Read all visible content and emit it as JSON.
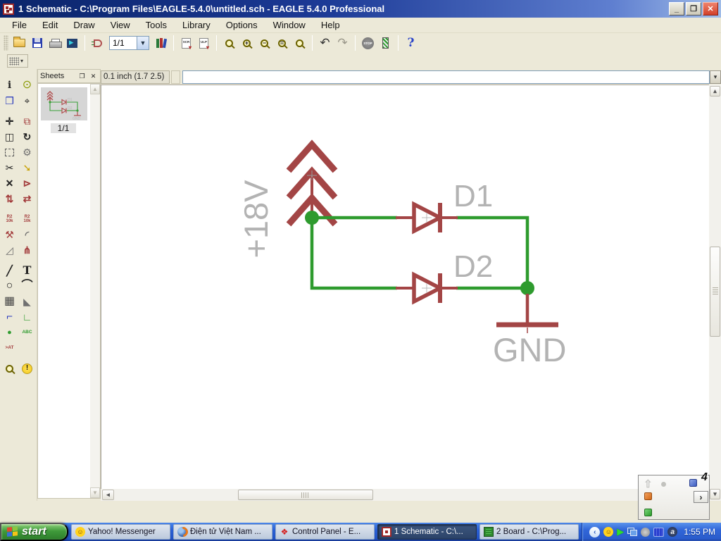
{
  "window": {
    "title": "1 Schematic - C:\\Program Files\\EAGLE-5.4.0\\untitled.sch - EAGLE 5.4.0 Professional",
    "minimize_glyph": "_",
    "restore_glyph": "❐",
    "close_glyph": "✕"
  },
  "menu": {
    "items": [
      "File",
      "Edit",
      "Draw",
      "View",
      "Tools",
      "Library",
      "Options",
      "Window",
      "Help"
    ]
  },
  "toolbar": {
    "sheet_selector": "1/1",
    "combo_arrow": "▼",
    "scr_label": "SCR",
    "ulp_label": "ULP",
    "zoom_in_overlay": "+",
    "zoom_out_overlay": "−",
    "zoom_select_overlay": "=",
    "undo_glyph": "↶",
    "redo_glyph": "↷",
    "stop_label": "STOP",
    "help_label": "?"
  },
  "command_bar": {
    "coordinate_display": "0.1 inch (1.7 2.5)",
    "command_value": ""
  },
  "sheets": {
    "title": "Sheets",
    "float_glyph": "❐",
    "close_glyph": "✕",
    "current_sheet": "1/1"
  },
  "palette": {
    "tools": [
      {
        "name": "info",
        "glyph": "i"
      },
      {
        "name": "show",
        "glyph": "⊙"
      },
      {
        "name": "display",
        "glyph": "❐"
      },
      {
        "name": "mark",
        "glyph": "⌖"
      },
      {
        "name": "move",
        "glyph": "✛"
      },
      {
        "name": "copy",
        "glyph": "⧉"
      },
      {
        "name": "mirror",
        "glyph": "◫"
      },
      {
        "name": "rotate",
        "glyph": "↻"
      },
      {
        "name": "group",
        "glyph": ""
      },
      {
        "name": "change",
        "glyph": "⚙"
      },
      {
        "name": "cut",
        "glyph": "✂"
      },
      {
        "name": "paste",
        "glyph": "➘"
      },
      {
        "name": "delete",
        "glyph": "✕"
      },
      {
        "name": "add",
        "glyph": "⊳"
      },
      {
        "name": "pinswap",
        "glyph": "⇅"
      },
      {
        "name": "gateswap",
        "glyph": "⇄"
      },
      {
        "name": "name",
        "glyph": "R2\n10k"
      },
      {
        "name": "value",
        "glyph": "R2\n10k"
      },
      {
        "name": "smash",
        "glyph": "⚒"
      },
      {
        "name": "miter",
        "glyph": "◜"
      },
      {
        "name": "miter2",
        "glyph": "◿"
      },
      {
        "name": "optimize",
        "glyph": "⋔"
      },
      {
        "name": "wire",
        "glyph": "╱"
      },
      {
        "name": "text",
        "glyph": "T"
      },
      {
        "name": "circle",
        "glyph": "○"
      },
      {
        "name": "arc",
        "glyph": "⌒"
      },
      {
        "name": "rect",
        "glyph": "▦"
      },
      {
        "name": "polygon",
        "glyph": "◣"
      },
      {
        "name": "bus",
        "glyph": "⌐"
      },
      {
        "name": "net",
        "glyph": "∟"
      },
      {
        "name": "junction",
        "glyph": "●"
      },
      {
        "name": "label",
        "glyph": "ABC"
      },
      {
        "name": "attribute",
        "glyph": ">AT"
      },
      {
        "name": "erc",
        "glyph": ""
      },
      {
        "name": "errors",
        "glyph": "!"
      }
    ]
  },
  "schematic": {
    "power_label": "+18V",
    "diode1_label": "D1",
    "diode2_label": "D2",
    "ground_label": "GND",
    "colors": {
      "net_wire": "#2e9b2e",
      "part_symbol": "#a34545",
      "label_text": "#b3b3b3"
    }
  },
  "popup": {
    "badge": "4",
    "next_glyph": "›",
    "ghost_glyph": "⇧"
  },
  "taskbar": {
    "start_label": "start",
    "tasks": [
      {
        "label": "Yahoo! Messenger"
      },
      {
        "label": "Điện tử Việt Nam ..."
      },
      {
        "label": "Control Panel - E..."
      },
      {
        "label": "1 Schematic - C:\\...",
        "active": true
      },
      {
        "label": "2 Board - C:\\Prog..."
      }
    ],
    "tray_chevron": "‹",
    "smiley_glyph": "☺",
    "play_glyph": "▶",
    "a_glyph": "a",
    "clock": "1:55 PM"
  }
}
